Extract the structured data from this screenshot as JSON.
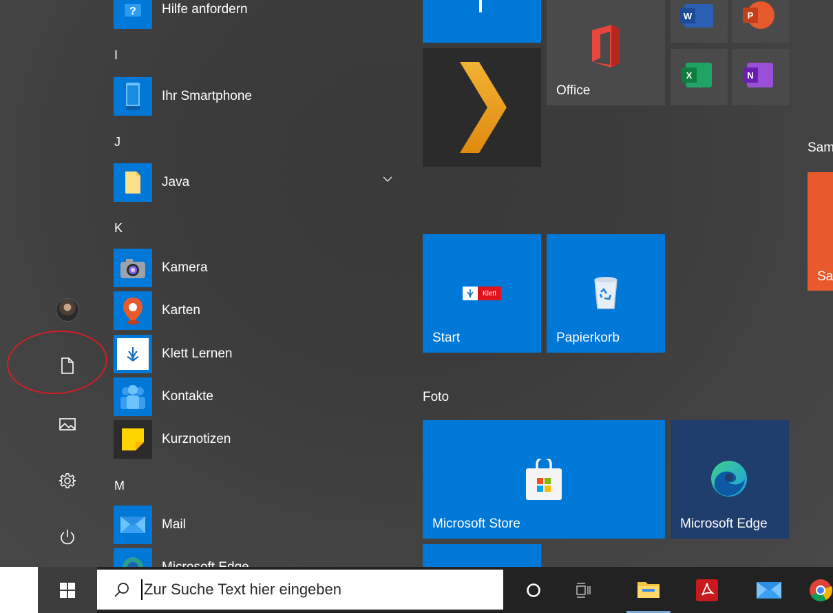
{
  "sidebar": {
    "items": [
      "user-avatar",
      "documents",
      "pictures",
      "settings",
      "power"
    ]
  },
  "app_list": {
    "top_item": "Hilfe anfordern",
    "letter_i": "I",
    "letter_j": "J",
    "letter_k": "K",
    "letter_m": "M",
    "items": [
      "Ihr Smartphone",
      "Java",
      "Kamera",
      "Karten",
      "Klett Lernen",
      "Kontakte",
      "Kurznotizen",
      "Mail",
      "Microsoft Edge"
    ]
  },
  "tiles": {
    "office_label": "Office",
    "start_label": "Start",
    "klett_logo_text": "Klett",
    "papierkorb_label": "Papierkorb",
    "group_foto": "Foto",
    "store_label": "Microsoft Store",
    "edge_label": "Microsoft Edge",
    "group_partial": "Sam",
    "orange_tile_label": "Sa",
    "word_letter": "W",
    "powerpoint_letter": "P",
    "excel_letter": "X",
    "onenote_letter": "N"
  },
  "taskbar": {
    "search_placeholder": "Zur Suche Text hier eingeben"
  },
  "colors": {
    "tile_blue": "#0078d7",
    "tile_dark": "#2b2b2b",
    "tile_gray": "#4a4a4a",
    "edge_tile": "#1f3e6e",
    "orange_tile": "#e8592b",
    "annotation": "#d21f26",
    "taskbar": "#222222"
  }
}
